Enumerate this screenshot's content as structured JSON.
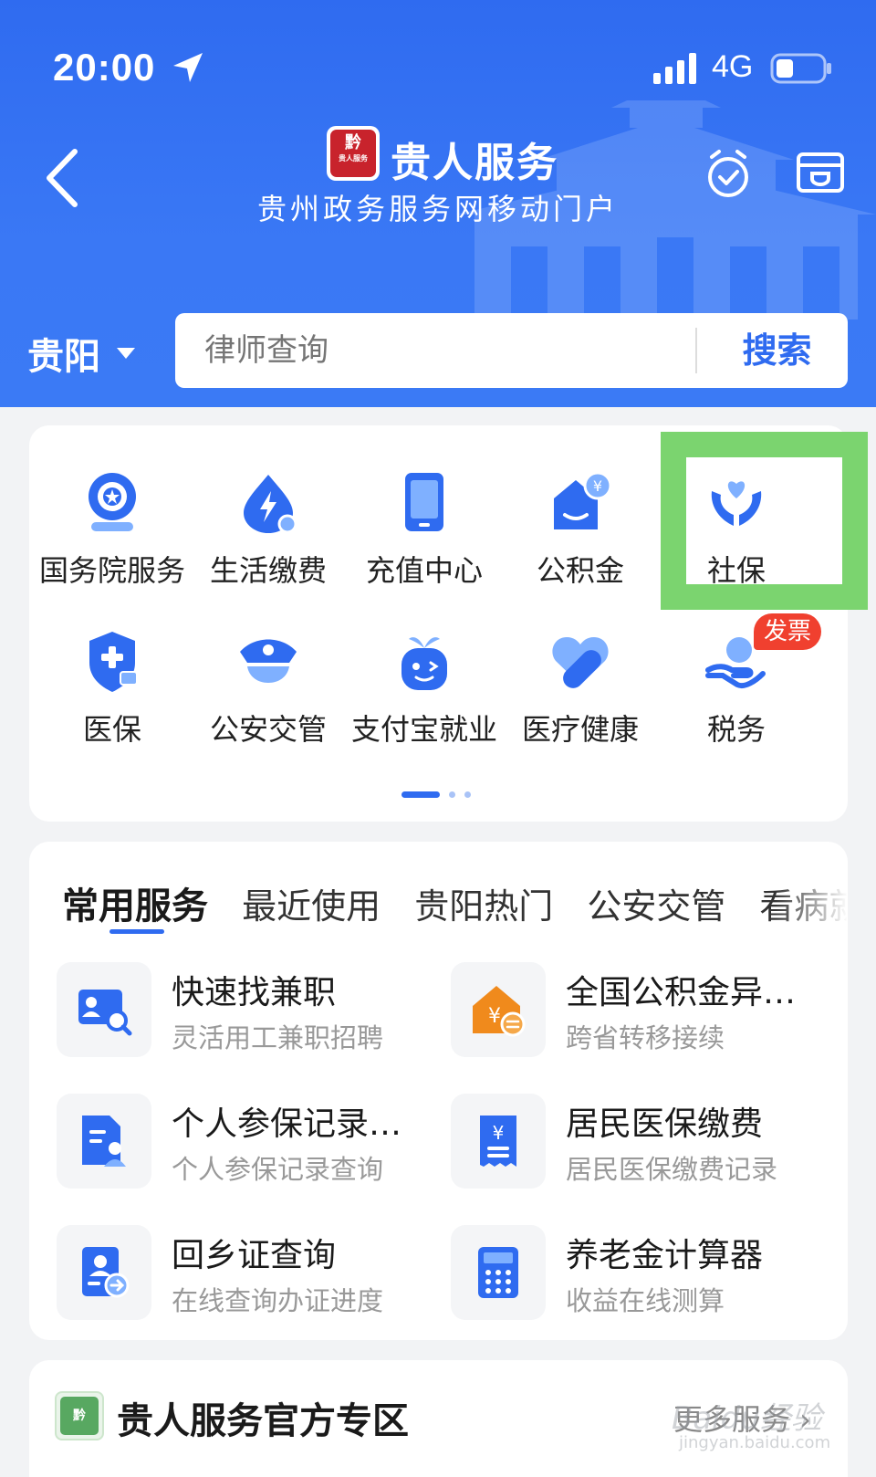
{
  "status_bar": {
    "time": "20:00",
    "network": "4G"
  },
  "header": {
    "app_title": "贵人服务",
    "subtitle": "贵州政务服务网移动门户",
    "logo_text": "黔",
    "logo_small": "贵人服务"
  },
  "search": {
    "city": "贵阳",
    "placeholder": "律师查询",
    "button_label": "搜索"
  },
  "grid": {
    "items": [
      {
        "label": "国务院服务",
        "icon": "state-council-icon"
      },
      {
        "label": "生活缴费",
        "icon": "utility-payment-icon"
      },
      {
        "label": "充值中心",
        "icon": "phone-recharge-icon"
      },
      {
        "label": "公积金",
        "icon": "housing-fund-icon"
      },
      {
        "label": "社保",
        "icon": "social-security-icon"
      },
      {
        "label": "医保",
        "icon": "medical-insurance-icon"
      },
      {
        "label": "公安交管",
        "icon": "police-cap-icon"
      },
      {
        "label": "支付宝就业",
        "icon": "alipay-employment-icon"
      },
      {
        "label": "医疗健康",
        "icon": "medical-health-icon"
      },
      {
        "label": "税务",
        "icon": "tax-icon"
      }
    ],
    "badge": "发票",
    "highlighted_item": "社保",
    "page_count": 3,
    "current_page": 1
  },
  "services": {
    "tabs": [
      "常用服务",
      "最近使用",
      "贵阳热门",
      "公安交管",
      "看病就"
    ],
    "active_tab": "常用服务",
    "items": [
      {
        "title": "快速找兼职",
        "desc": "灵活用工兼职招聘",
        "icon": "id-card-search-icon"
      },
      {
        "title": "全国公积金异…",
        "desc": "跨省转移接续",
        "icon": "house-transfer-icon"
      },
      {
        "title": "个人参保记录…",
        "desc": "个人参保记录查询",
        "icon": "insurance-record-icon"
      },
      {
        "title": "居民医保缴费",
        "desc": "居民医保缴费记录",
        "icon": "receipt-yuan-icon"
      },
      {
        "title": "回乡证查询",
        "desc": "在线查询办证进度",
        "icon": "permit-query-icon"
      },
      {
        "title": "养老金计算器",
        "desc": "收益在线测算",
        "icon": "calculator-icon"
      }
    ]
  },
  "zone": {
    "title": "贵人服务官方专区",
    "more_label": "更多服务 ›",
    "logo_text": "黔"
  },
  "watermark": {
    "text": "Baidu经验",
    "sub": "jingyan.baidu.com"
  },
  "colors": {
    "primary": "#2f6bf0",
    "highlight": "#7bd46f",
    "badge": "#f0402f",
    "logo_red": "#c8232c"
  }
}
